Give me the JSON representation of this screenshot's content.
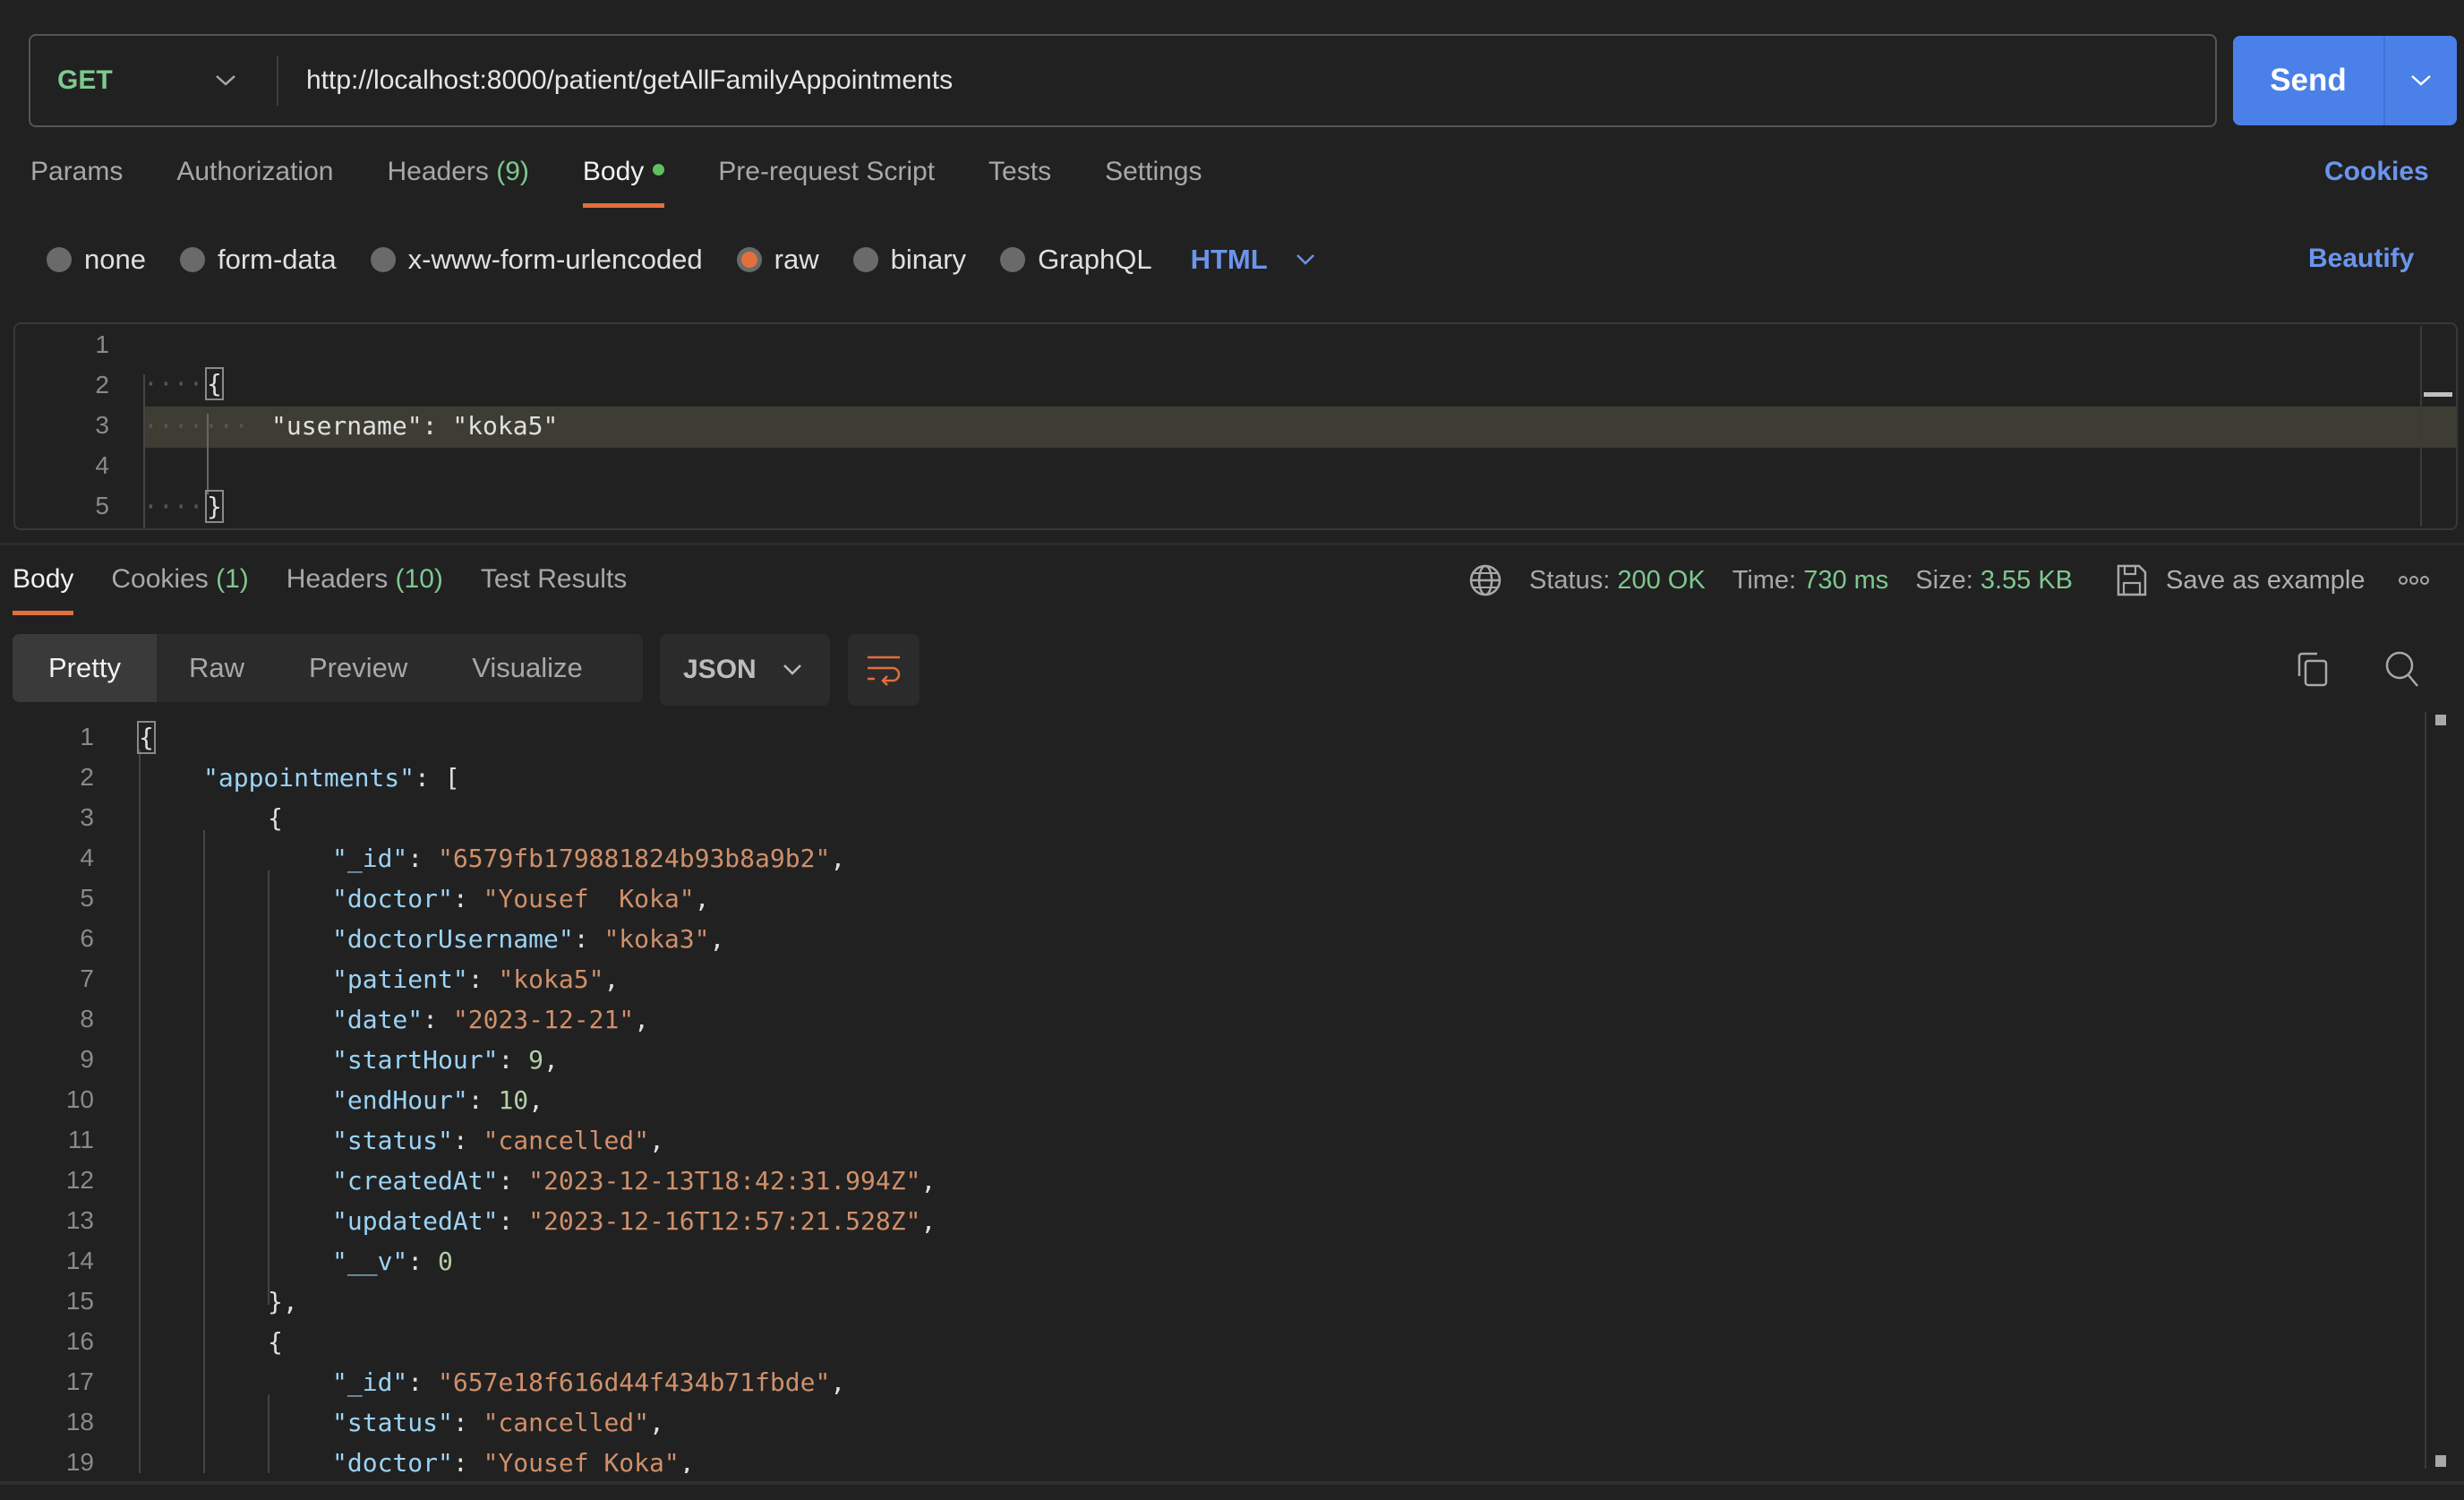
{
  "request": {
    "method": "GET",
    "url": "http://localhost:8000/patient/getAllFamilyAppointments",
    "send_label": "Send"
  },
  "request_tabs": [
    {
      "label": "Params",
      "count": null,
      "active": false
    },
    {
      "label": "Authorization",
      "count": null,
      "active": false
    },
    {
      "label": "Headers",
      "count": "(9)",
      "active": false
    },
    {
      "label": "Body",
      "count": null,
      "active": true,
      "modified_dot": true
    },
    {
      "label": "Pre-request Script",
      "count": null,
      "active": false
    },
    {
      "label": "Tests",
      "count": null,
      "active": false
    },
    {
      "label": "Settings",
      "count": null,
      "active": false
    }
  ],
  "cookies_link": "Cookies",
  "body_types": [
    {
      "label": "none",
      "selected": false
    },
    {
      "label": "form-data",
      "selected": false
    },
    {
      "label": "x-www-form-urlencoded",
      "selected": false
    },
    {
      "label": "raw",
      "selected": true
    },
    {
      "label": "binary",
      "selected": false
    },
    {
      "label": "GraphQL",
      "selected": false
    }
  ],
  "raw_language": "HTML",
  "beautify_label": "Beautify",
  "request_body": {
    "lines": [
      "",
      "{",
      "    \"username\": \"koka5\"",
      "",
      "}"
    ],
    "line_numbers": [
      "1",
      "2",
      "3",
      "4",
      "5"
    ],
    "key": "\"username\"",
    "value": "\"koka5\""
  },
  "response_tabs": [
    {
      "label": "Body",
      "count": null,
      "active": true
    },
    {
      "label": "Cookies",
      "count": "(1)",
      "active": false
    },
    {
      "label": "Headers",
      "count": "(10)",
      "active": false
    },
    {
      "label": "Test Results",
      "count": null,
      "active": false
    }
  ],
  "response_meta": {
    "status_label": "Status:",
    "status_value": "200 OK",
    "time_label": "Time:",
    "time_value": "730 ms",
    "size_label": "Size:",
    "size_value": "3.55 KB",
    "save_example_label": "Save as example",
    "more_label": "ooo"
  },
  "view_modes": [
    {
      "label": "Pretty",
      "active": true
    },
    {
      "label": "Raw",
      "active": false
    },
    {
      "label": "Preview",
      "active": false
    },
    {
      "label": "Visualize",
      "active": false
    }
  ],
  "response_format": "JSON",
  "response_body": {
    "line_numbers": [
      "1",
      "2",
      "3",
      "4",
      "5",
      "6",
      "7",
      "8",
      "9",
      "10",
      "11",
      "12",
      "13",
      "14",
      "15",
      "16",
      "17",
      "18",
      "19"
    ],
    "lines": [
      {
        "indent": 0,
        "parts": [
          {
            "t": "p",
            "v": "{"
          }
        ]
      },
      {
        "indent": 1,
        "parts": [
          {
            "t": "k",
            "v": "\"appointments\""
          },
          {
            "t": "p",
            "v": ": ["
          }
        ]
      },
      {
        "indent": 2,
        "parts": [
          {
            "t": "p",
            "v": "{"
          }
        ]
      },
      {
        "indent": 3,
        "parts": [
          {
            "t": "k",
            "v": "\"_id\""
          },
          {
            "t": "p",
            "v": ": "
          },
          {
            "t": "s",
            "v": "\"6579fb179881824b93b8a9b2\""
          },
          {
            "t": "p",
            "v": ","
          }
        ]
      },
      {
        "indent": 3,
        "parts": [
          {
            "t": "k",
            "v": "\"doctor\""
          },
          {
            "t": "p",
            "v": ": "
          },
          {
            "t": "s",
            "v": "\"Yousef  Koka\""
          },
          {
            "t": "p",
            "v": ","
          }
        ]
      },
      {
        "indent": 3,
        "parts": [
          {
            "t": "k",
            "v": "\"doctorUsername\""
          },
          {
            "t": "p",
            "v": ": "
          },
          {
            "t": "s",
            "v": "\"koka3\""
          },
          {
            "t": "p",
            "v": ","
          }
        ]
      },
      {
        "indent": 3,
        "parts": [
          {
            "t": "k",
            "v": "\"patient\""
          },
          {
            "t": "p",
            "v": ": "
          },
          {
            "t": "s",
            "v": "\"koka5\""
          },
          {
            "t": "p",
            "v": ","
          }
        ]
      },
      {
        "indent": 3,
        "parts": [
          {
            "t": "k",
            "v": "\"date\""
          },
          {
            "t": "p",
            "v": ": "
          },
          {
            "t": "s",
            "v": "\"2023-12-21\""
          },
          {
            "t": "p",
            "v": ","
          }
        ]
      },
      {
        "indent": 3,
        "parts": [
          {
            "t": "k",
            "v": "\"startHour\""
          },
          {
            "t": "p",
            "v": ": "
          },
          {
            "t": "n",
            "v": "9"
          },
          {
            "t": "p",
            "v": ","
          }
        ]
      },
      {
        "indent": 3,
        "parts": [
          {
            "t": "k",
            "v": "\"endHour\""
          },
          {
            "t": "p",
            "v": ": "
          },
          {
            "t": "n",
            "v": "10"
          },
          {
            "t": "p",
            "v": ","
          }
        ]
      },
      {
        "indent": 3,
        "parts": [
          {
            "t": "k",
            "v": "\"status\""
          },
          {
            "t": "p",
            "v": ": "
          },
          {
            "t": "s",
            "v": "\"cancelled\""
          },
          {
            "t": "p",
            "v": ","
          }
        ]
      },
      {
        "indent": 3,
        "parts": [
          {
            "t": "k",
            "v": "\"createdAt\""
          },
          {
            "t": "p",
            "v": ": "
          },
          {
            "t": "s",
            "v": "\"2023-12-13T18:42:31.994Z\""
          },
          {
            "t": "p",
            "v": ","
          }
        ]
      },
      {
        "indent": 3,
        "parts": [
          {
            "t": "k",
            "v": "\"updatedAt\""
          },
          {
            "t": "p",
            "v": ": "
          },
          {
            "t": "s",
            "v": "\"2023-12-16T12:57:21.528Z\""
          },
          {
            "t": "p",
            "v": ","
          }
        ]
      },
      {
        "indent": 3,
        "parts": [
          {
            "t": "k",
            "v": "\"__v\""
          },
          {
            "t": "p",
            "v": ": "
          },
          {
            "t": "n",
            "v": "0"
          }
        ]
      },
      {
        "indent": 2,
        "parts": [
          {
            "t": "p",
            "v": "},"
          }
        ]
      },
      {
        "indent": 2,
        "parts": [
          {
            "t": "p",
            "v": "{"
          }
        ]
      },
      {
        "indent": 3,
        "parts": [
          {
            "t": "k",
            "v": "\"_id\""
          },
          {
            "t": "p",
            "v": ": "
          },
          {
            "t": "s",
            "v": "\"657e18f616d44f434b71fbde\""
          },
          {
            "t": "p",
            "v": ","
          }
        ]
      },
      {
        "indent": 3,
        "parts": [
          {
            "t": "k",
            "v": "\"status\""
          },
          {
            "t": "p",
            "v": ": "
          },
          {
            "t": "s",
            "v": "\"cancelled\""
          },
          {
            "t": "p",
            "v": ","
          }
        ]
      },
      {
        "indent": 3,
        "parts": [
          {
            "t": "k",
            "v": "\"doctor\""
          },
          {
            "t": "p",
            "v": ": "
          },
          {
            "t": "s",
            "v": "\"Yousef Koka\""
          },
          {
            "t": "p",
            "v": ","
          }
        ]
      }
    ]
  },
  "colors": {
    "accent_blue": "#4a80e8",
    "active_tab_underline": "#e36f3d",
    "status_green": "#7ec98f",
    "link_blue": "#6b95ec"
  }
}
